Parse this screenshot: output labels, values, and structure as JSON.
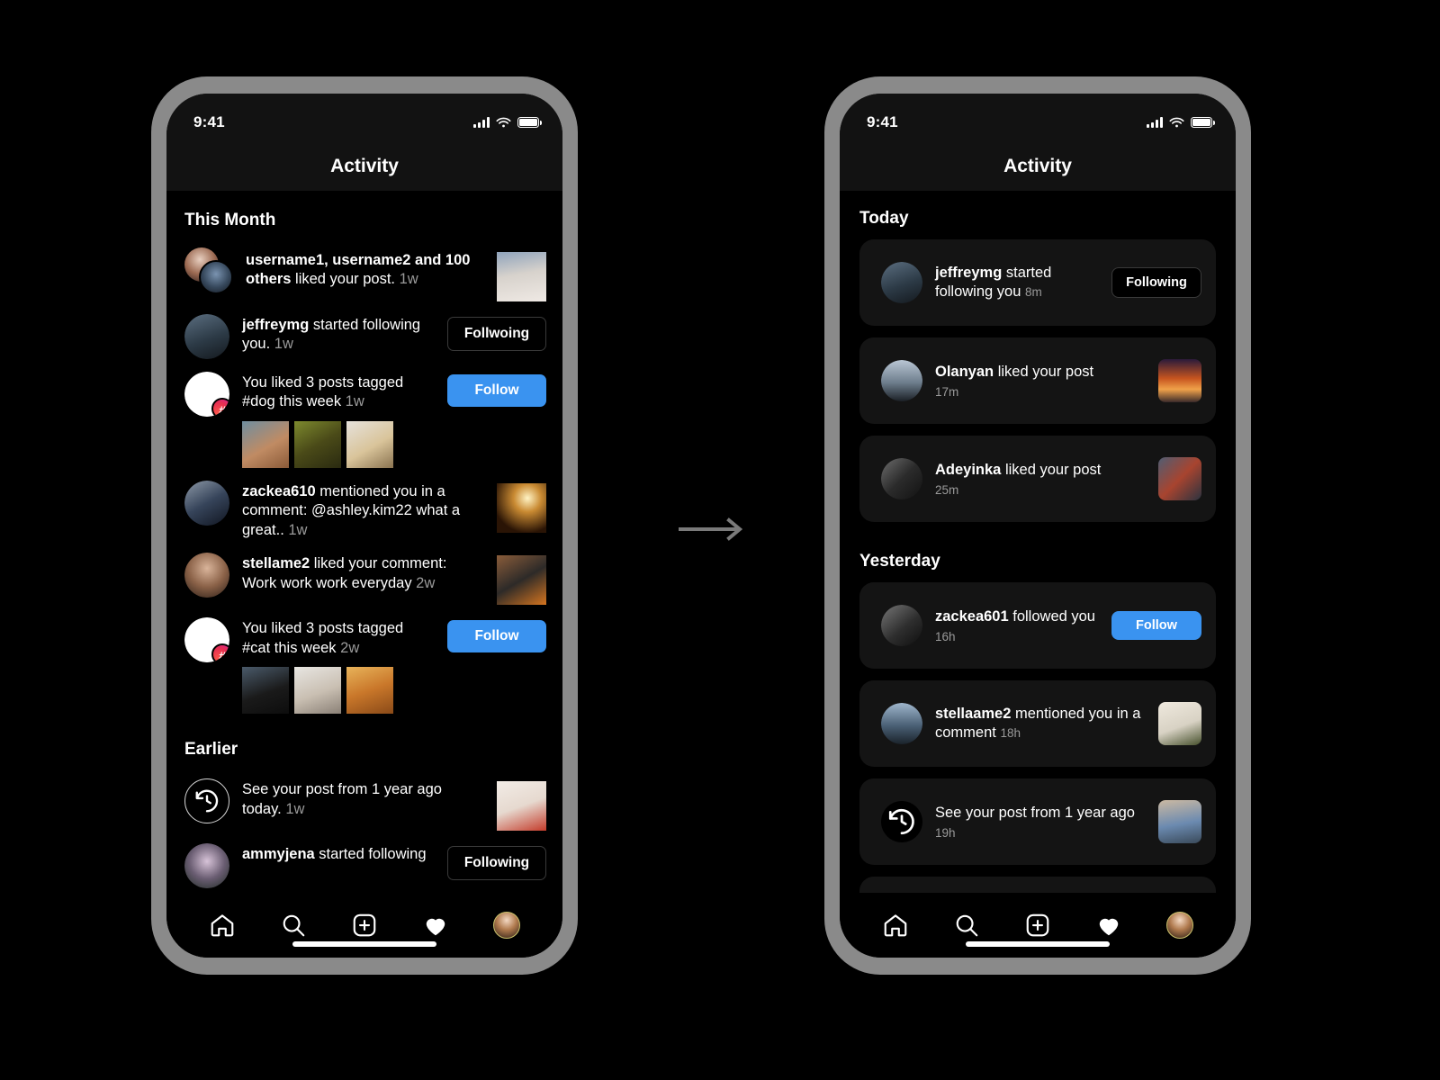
{
  "meta": {
    "accent_blue": "#3a93f0",
    "card_bg": "#141414",
    "frame_color": "#8a8a8a",
    "muted_text": "#9a9a9a"
  },
  "status_bar": {
    "time": "9:41",
    "signal": "signal-bars",
    "wifi": "wifi-icon",
    "battery": "battery-icon"
  },
  "header": {
    "title": "Activity"
  },
  "left_phone": {
    "sections": [
      {
        "title": "This Month",
        "rows": [
          {
            "kind": "like-multi",
            "avatar": "double-avatar",
            "text_parts": [
              {
                "t": "username1, username2 and 100 others",
                "bold": true
              },
              {
                "t": " liked your post. ",
                "bold": false
              },
              {
                "t": "1w",
                "muted": true
              }
            ],
            "right": {
              "type": "post-thumb",
              "name": "post-thumbnail-kittens"
            }
          },
          {
            "kind": "follow",
            "avatar": "avatar-jeffreymg",
            "text_parts": [
              {
                "t": "jeffreymg",
                "bold": true
              },
              {
                "t": " started following you. ",
                "bold": false
              },
              {
                "t": "1w",
                "muted": true
              }
            ],
            "right": {
              "type": "button",
              "style": "following",
              "label": "Follwoing"
            }
          },
          {
            "kind": "hashtag",
            "avatar": "hashtag-avatar",
            "text_parts": [
              {
                "t": "You liked 3 posts tagged #dog this week ",
                "bold": false
              },
              {
                "t": "1w",
                "muted": true
              }
            ],
            "thumbs": [
              "dog-thumb-1",
              "dog-thumb-2",
              "dog-thumb-3"
            ],
            "right": {
              "type": "button",
              "style": "follow",
              "label": "Follow"
            }
          },
          {
            "kind": "mention",
            "avatar": "avatar-zackea610",
            "text_parts": [
              {
                "t": "zackea610",
                "bold": true
              },
              {
                "t": " mentioned you in a comment: @ashley.kim22 what a great.. ",
                "bold": false
              },
              {
                "t": "1w",
                "muted": true
              }
            ],
            "right": {
              "type": "post-thumb",
              "name": "post-thumbnail-lamp"
            }
          },
          {
            "kind": "comment-like",
            "avatar": "avatar-stellame2",
            "text_parts": [
              {
                "t": "stellame2",
                "bold": true
              },
              {
                "t": " liked your comment: Work work work everyday ",
                "bold": false
              },
              {
                "t": "2w",
                "muted": true
              }
            ],
            "right": {
              "type": "post-thumb",
              "name": "post-thumbnail-desk"
            }
          },
          {
            "kind": "hashtag",
            "avatar": "hashtag-avatar",
            "text_parts": [
              {
                "t": "You liked 3 posts tagged #cat this week ",
                "bold": false
              },
              {
                "t": "2w",
                "muted": true
              }
            ],
            "thumbs": [
              "cat-thumb-1",
              "cat-thumb-2",
              "cat-thumb-3"
            ],
            "right": {
              "type": "button",
              "style": "follow",
              "label": "Follow"
            }
          }
        ]
      },
      {
        "title": "Earlier",
        "rows": [
          {
            "kind": "memory",
            "avatar": "history-clock-icon",
            "text_parts": [
              {
                "t": "See your post from 1 year ago today. ",
                "bold": false
              },
              {
                "t": "1w",
                "muted": true
              }
            ],
            "right": {
              "type": "post-thumb",
              "name": "post-thumbnail-brunch"
            }
          },
          {
            "kind": "follow",
            "avatar": "avatar-ammyjena",
            "text_parts": [
              {
                "t": "ammyjena",
                "bold": true
              },
              {
                "t": " started following",
                "bold": false
              }
            ],
            "right": {
              "type": "button",
              "style": "following",
              "label": "Following"
            }
          }
        ]
      }
    ]
  },
  "right_phone": {
    "sections": [
      {
        "title": "Today",
        "cards": [
          {
            "avatar": "avatar-jeffreymg",
            "text_parts": [
              {
                "t": "jeffreymg",
                "bold": true
              },
              {
                "t": " started following you  ",
                "bold": false
              }
            ],
            "inline_time": "8m",
            "right": {
              "type": "button",
              "style": "following",
              "label": "Following"
            }
          },
          {
            "avatar": "avatar-olanyan",
            "text_parts": [
              {
                "t": "Olanyan",
                "bold": true
              },
              {
                "t": " liked your post",
                "bold": false
              }
            ],
            "time": "17m",
            "right": {
              "type": "thumb",
              "name": "post-thumbnail-sunset"
            }
          },
          {
            "avatar": "avatar-adeyinka",
            "text_parts": [
              {
                "t": "Adeyinka",
                "bold": true
              },
              {
                "t": " liked your post",
                "bold": false
              }
            ],
            "time": "25m",
            "right": {
              "type": "thumb",
              "name": "post-thumbnail-crowd"
            }
          }
        ]
      },
      {
        "title": "Yesterday",
        "cards": [
          {
            "avatar": "avatar-zackea601",
            "text_parts": [
              {
                "t": "zackea601",
                "bold": true
              },
              {
                "t": " followed you",
                "bold": false
              }
            ],
            "time": "16h",
            "right": {
              "type": "button",
              "style": "follow",
              "label": "Follow"
            }
          },
          {
            "avatar": "avatar-stellaame2",
            "text_parts": [
              {
                "t": "stellaame2",
                "bold": true
              },
              {
                "t": " mentioned you in a comment  ",
                "bold": false
              }
            ],
            "inline_time": "18h",
            "right": {
              "type": "thumb",
              "name": "post-thumbnail-leaf"
            }
          },
          {
            "avatar": "history-clock-icon",
            "text_parts": [
              {
                "t": "See your post from 1 year ago",
                "bold": false
              }
            ],
            "time": "19h",
            "right": {
              "type": "thumb",
              "name": "post-thumbnail-couple"
            }
          }
        ]
      }
    ]
  },
  "tabbar": {
    "items": [
      {
        "icon": "home-icon",
        "label": "Home"
      },
      {
        "icon": "search-icon",
        "label": "Search"
      },
      {
        "icon": "plus-square-icon",
        "label": "Create"
      },
      {
        "icon": "heart-icon",
        "label": "Activity",
        "active": true
      },
      {
        "icon": "profile-avatar",
        "label": "Profile"
      }
    ]
  },
  "arrow": {
    "name": "right-arrow",
    "color": "#7a7a7a"
  }
}
